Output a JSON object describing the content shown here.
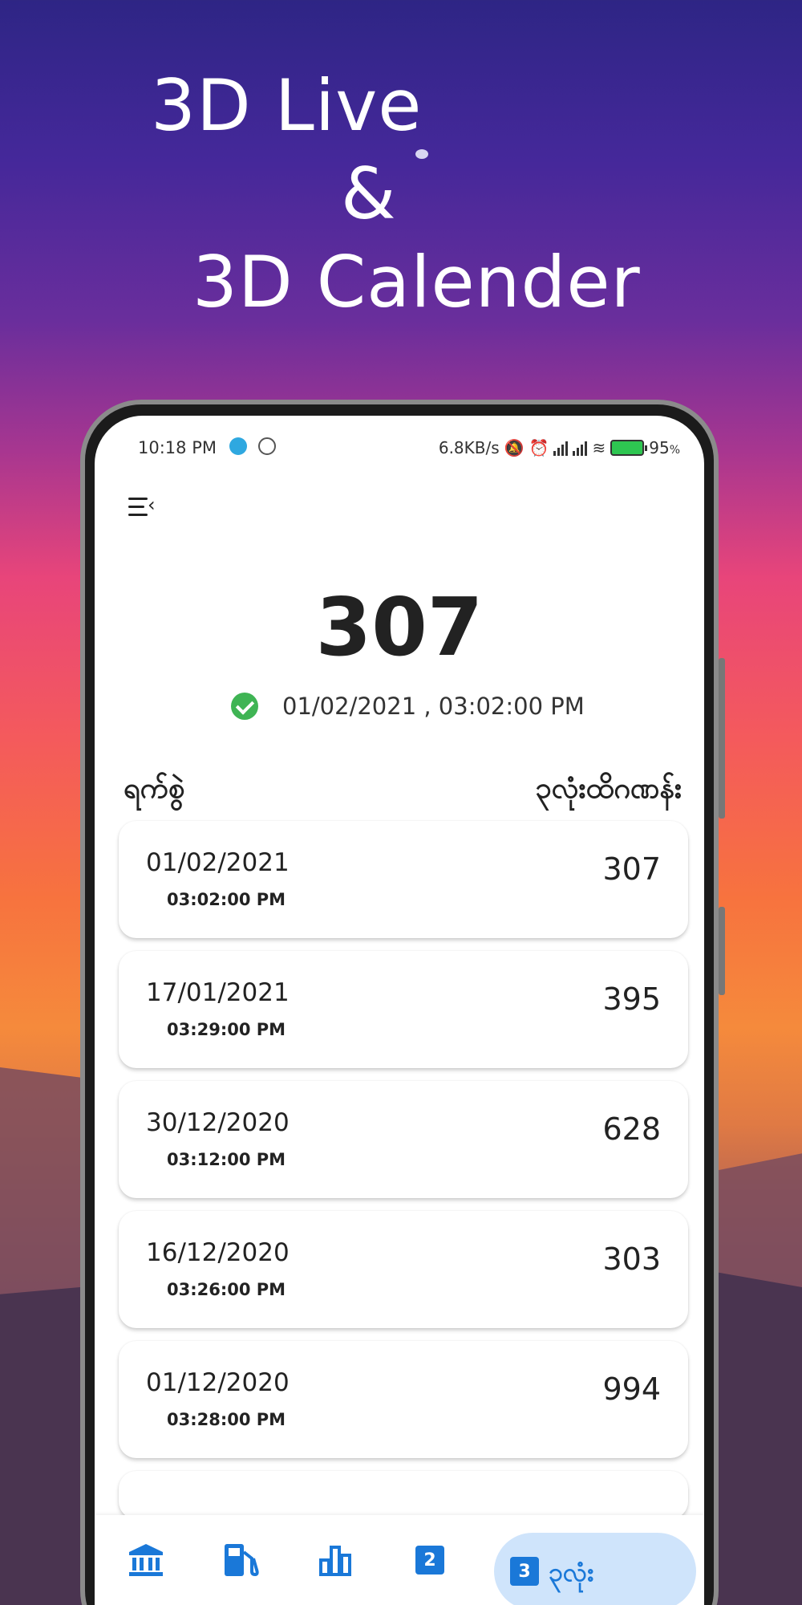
{
  "promo": {
    "line1": "3D Live",
    "line2": "&",
    "line3": "3D Calender"
  },
  "status_bar": {
    "time": "10:18 PM",
    "net_speed": "6.8KB/s",
    "battery": "95",
    "battery_unit": "%"
  },
  "main": {
    "current_number": "307",
    "last_update": "01/02/2021 , 03:02:00 PM",
    "col_date": "ရက်စွဲ",
    "col_number": "၃လုံးထိဂဏန်း"
  },
  "results": [
    {
      "date": "01/02/2021",
      "time": "03:02:00 PM",
      "number": "307"
    },
    {
      "date": "17/01/2021",
      "time": "03:29:00 PM",
      "number": "395"
    },
    {
      "date": "30/12/2020",
      "time": "03:12:00 PM",
      "number": "628"
    },
    {
      "date": "16/12/2020",
      "time": "03:26:00 PM",
      "number": "303"
    },
    {
      "date": "01/12/2020",
      "time": "03:28:00 PM",
      "number": "994"
    }
  ],
  "nav": {
    "items": [
      {
        "icon": "bank-icon"
      },
      {
        "icon": "fuel-icon"
      },
      {
        "icon": "bar-chart-icon"
      },
      {
        "icon": "number-2-icon",
        "badge": "2"
      },
      {
        "icon": "number-3-icon",
        "badge": "3",
        "label": "၃လုံး",
        "active": true
      }
    ]
  },
  "colors": {
    "accent": "#1a78d8",
    "active_tab_bg": "#cfe4fb",
    "success": "#3fb454"
  }
}
